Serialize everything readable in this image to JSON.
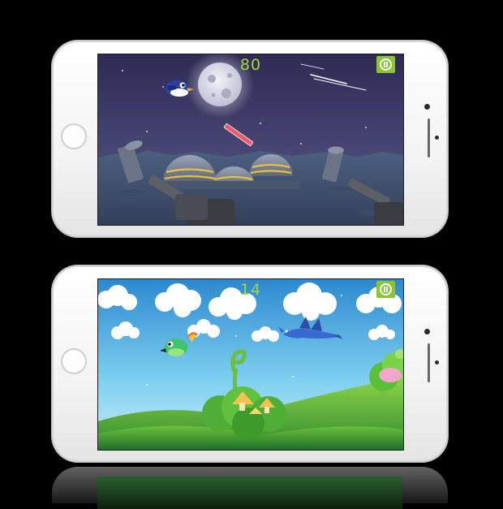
{
  "screens": [
    {
      "id": "space-level",
      "score": "80"
    },
    {
      "id": "sky-level",
      "score": "14"
    }
  ],
  "icons": {
    "pause": "pause-icon",
    "home": "home-button",
    "camera": "camera-icon"
  },
  "colors": {
    "score_text": "#a5d63a",
    "pause_button": "#8dc33a",
    "space_sky": "#3d3b6b",
    "day_sky": "#5fc0ea",
    "grass": "#5fb83a"
  }
}
